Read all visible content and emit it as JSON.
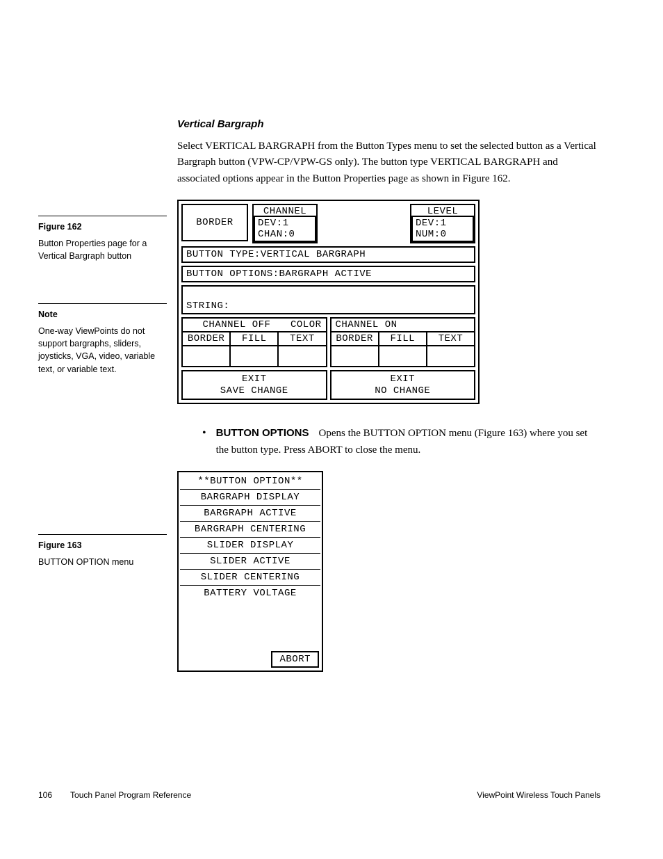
{
  "section_title": "Vertical Bargraph",
  "intro_paragraph": "Select VERTICAL BARGRAPH from the Button Types menu to set the selected button as a Vertical Bargraph button (VPW-CP/VPW-GS only). The button type VERTICAL BARGRAPH and associated options appear in the Button Properties page as shown in Figure 162.",
  "sidebar": {
    "fig162_label": "Figure 162",
    "fig162_caption": "Button Properties page for a Vertical Bargraph button",
    "note_label": "Note",
    "note_text": "One-way ViewPoints do not support bargraphs, sliders, joysticks, VGA, video, variable text, or variable text.",
    "fig163_label": "Figure 163",
    "fig163_caption": "BUTTON OPTION menu"
  },
  "fig162": {
    "border": "BORDER",
    "channel": "CHANNEL",
    "channel_dev": "DEV:1",
    "channel_chan": "CHAN:0",
    "level": "LEVEL",
    "level_dev": "DEV:1",
    "level_num": "NUM:0",
    "button_type": "BUTTON TYPE:VERTICAL BARGRAPH",
    "button_options": "BUTTON OPTIONS:BARGRAPH ACTIVE",
    "string": "STRING:",
    "channel_off": "CHANNEL OFF",
    "color": "COLOR",
    "channel_on": "CHANNEL ON",
    "col_border": "BORDER",
    "col_fill": "FILL",
    "col_text": "TEXT",
    "exit_save_l1": "EXIT",
    "exit_save_l2": "SAVE CHANGE",
    "exit_no_l1": "EXIT",
    "exit_no_l2": "NO CHANGE"
  },
  "bullet": {
    "label": "BUTTON OPTIONS",
    "text": "Opens the BUTTON OPTION menu (Figure 163) where you set the button type. Press ABORT to close the menu."
  },
  "fig163": {
    "title": "**BUTTON OPTION**",
    "items": [
      "BARGRAPH DISPLAY",
      "BARGRAPH ACTIVE",
      "BARGRAPH CENTERING",
      "SLIDER DISPLAY",
      "SLIDER ACTIVE",
      "SLIDER CENTERING",
      "BATTERY VOLTAGE"
    ],
    "abort": "ABORT"
  },
  "footer": {
    "page_num": "106",
    "doc_title": "Touch Panel Program Reference",
    "product": "ViewPoint Wireless Touch Panels"
  }
}
